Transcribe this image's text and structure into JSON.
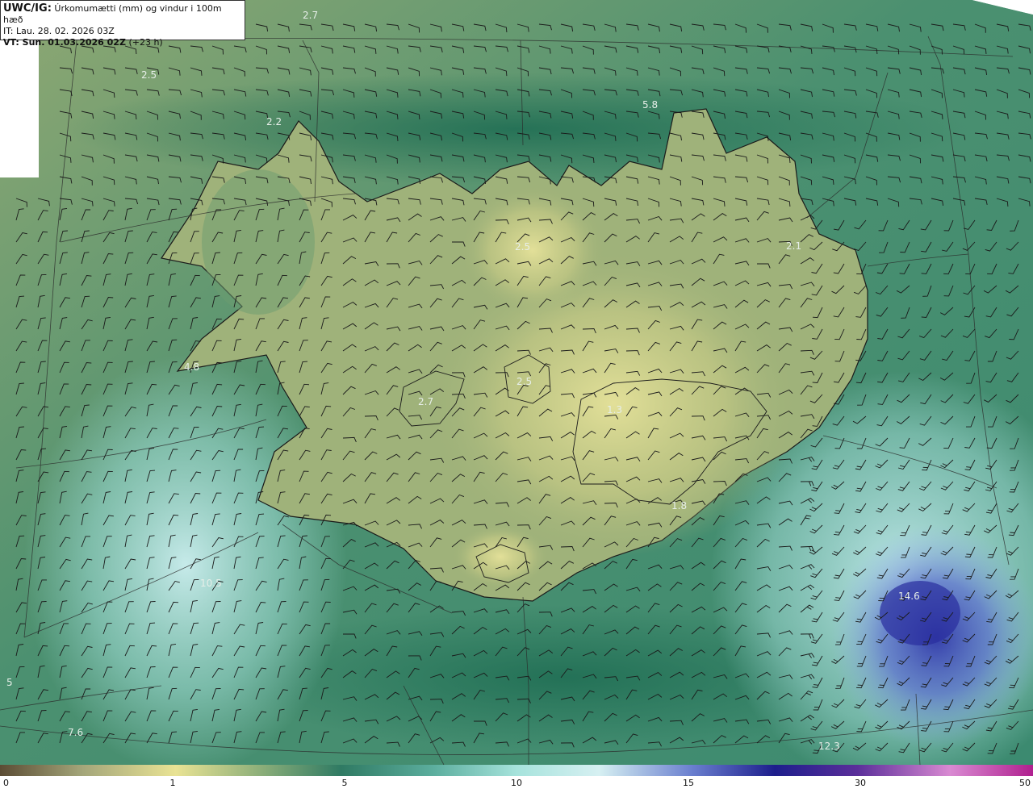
{
  "header": {
    "model_tag": "UWC/IG:",
    "title": "Úrkomumætti (mm) og vindur i 100m hæð",
    "init_time": "IT: Lau. 28. 02. 2026 03Z",
    "valid_label": "VT: Sun. 01.03.2026 02Z",
    "lead": "(+23 h)"
  },
  "map_labels": [
    {
      "text": "2.7"
    },
    {
      "text": "2.5"
    },
    {
      "text": "2.2"
    },
    {
      "text": "5.8"
    },
    {
      "text": "2.5"
    },
    {
      "text": "2.1"
    },
    {
      "text": "4.8"
    },
    {
      "text": "2.7"
    },
    {
      "text": "2.5"
    },
    {
      "text": "1.3"
    },
    {
      "text": "1.8"
    },
    {
      "text": "10.5"
    },
    {
      "text": "14.6"
    },
    {
      "text": "7.6"
    },
    {
      "text": "12.3"
    },
    {
      "text": "5"
    }
  ],
  "colorbar": {
    "ticks": [
      "0",
      "1",
      "5",
      "10",
      "15",
      "30",
      "50"
    ],
    "colors": [
      "#5b4c34",
      "#a4a67a",
      "#e9e394",
      "#8fb07a",
      "#2f7a63",
      "#5cae9e",
      "#a6e3dc",
      "#d6f0f2",
      "#6a7fcf",
      "#1d1e8c",
      "#5b2f9a",
      "#d98ad2",
      "#b0208f"
    ]
  },
  "map_colors": {
    "ocean_green": "#2c7a5f",
    "land_yellow": "#cfd08a",
    "cyan": "#b9ebe6",
    "blue": "#3a44b0",
    "outline": "#1a1a1a"
  }
}
